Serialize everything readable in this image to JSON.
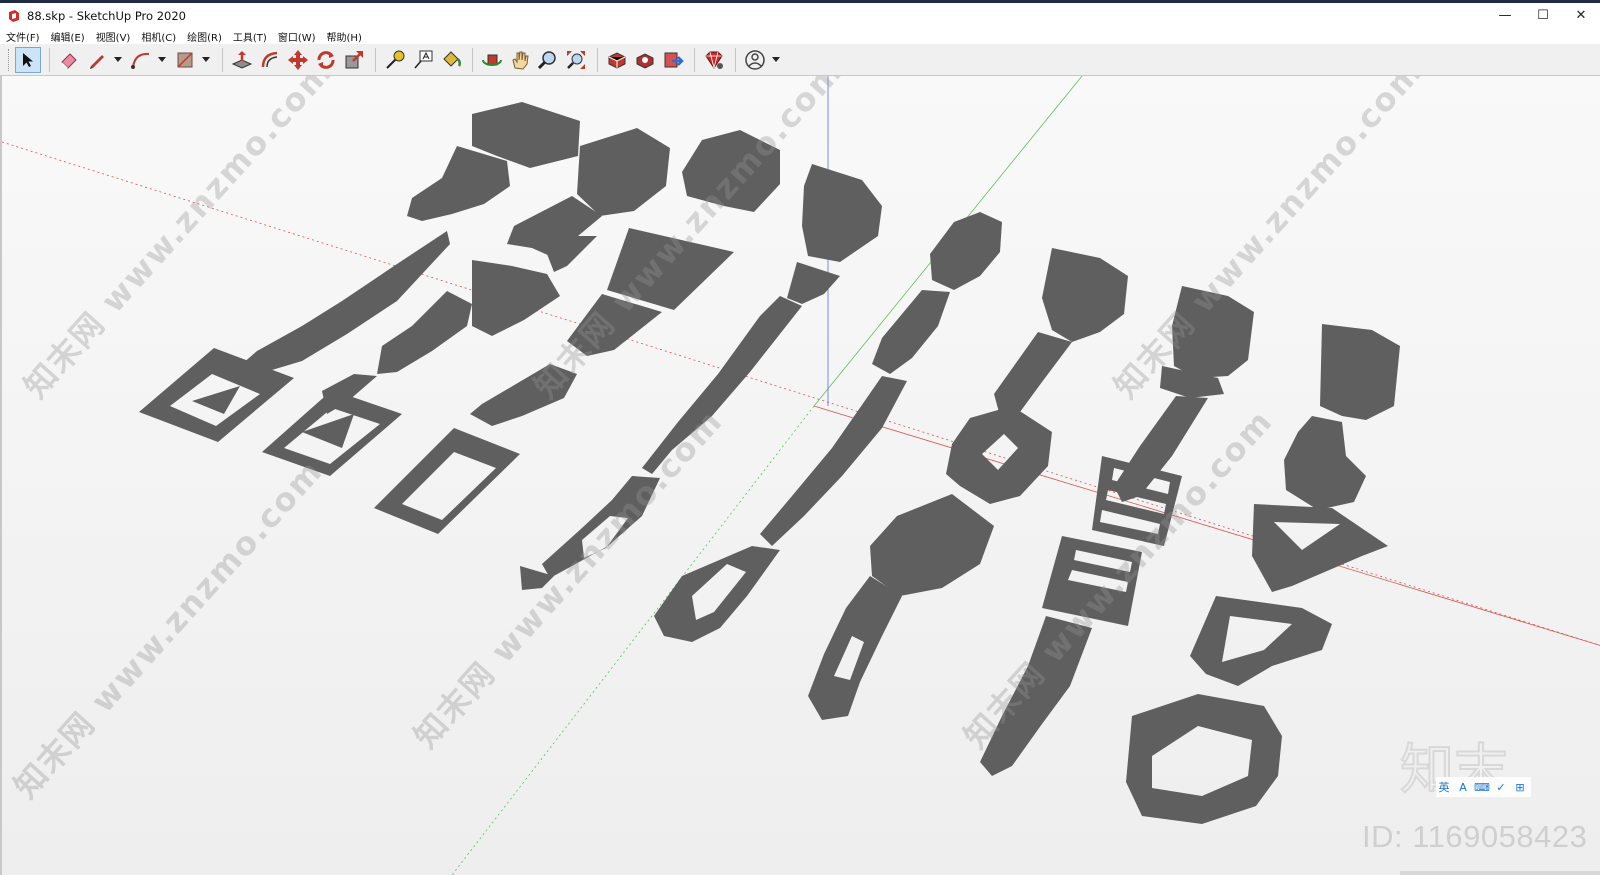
{
  "window": {
    "title": "88.skp - SketchUp Pro 2020",
    "minimize_glyph": "—",
    "maximize_glyph": "☐",
    "close_glyph": "✕"
  },
  "menu": {
    "items": [
      "文件(F)",
      "编辑(E)",
      "视图(V)",
      "相机(C)",
      "绘图(R)",
      "工具(T)",
      "窗口(W)",
      "帮助(H)"
    ]
  },
  "toolbar": {
    "icons": [
      "select-arrow-icon",
      "eraser-icon",
      "pencil-line-icon",
      "arc-icon",
      "rectangle-shape-icon",
      "push-pull-icon",
      "offset-icon",
      "move-icon",
      "rotate-icon",
      "scale-icon",
      "tape-measure-icon",
      "text-label-icon",
      "paint-bucket-icon",
      "orbit-icon",
      "pan-hand-icon",
      "zoom-icon",
      "zoom-extents-icon",
      "3d-warehouse-icon",
      "extension-warehouse-icon",
      "send-to-layout-icon",
      "extension-manager-icon",
      "user-account-icon"
    ]
  },
  "watermark": {
    "text": "知末网 www.znzmo.com",
    "brand_mark": "知末",
    "id_label": "ID: 1169058423"
  },
  "ime": {
    "icons": [
      "英",
      "A",
      "⌨",
      "✓",
      "⊞"
    ]
  },
  "colors": {
    "model_gray": "#5f5f5f",
    "axis_red": "#d9534f",
    "axis_green": "#5cbf5c",
    "axis_blue": "#5c6fd6",
    "toolbar_bg": "#f0f0f0",
    "viewport_bg": "#f4f4f4"
  }
}
